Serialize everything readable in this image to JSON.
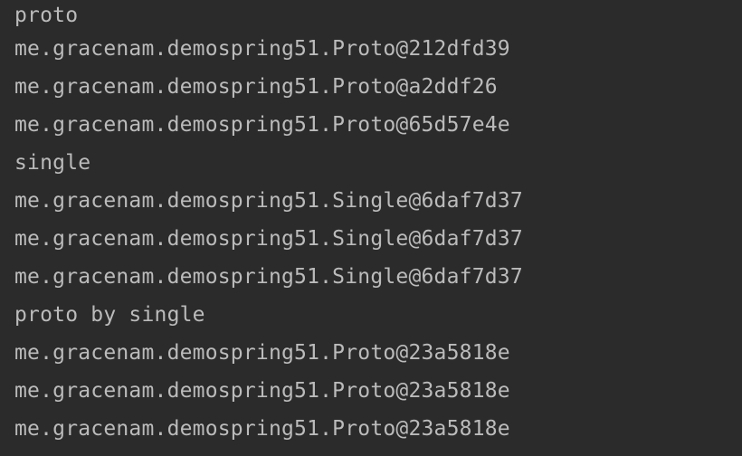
{
  "console": {
    "lines": [
      "proto",
      "me.gracenam.demospring51.Proto@212dfd39",
      "me.gracenam.demospring51.Proto@a2ddf26",
      "me.gracenam.demospring51.Proto@65d57e4e",
      "single",
      "me.gracenam.demospring51.Single@6daf7d37",
      "me.gracenam.demospring51.Single@6daf7d37",
      "me.gracenam.demospring51.Single@6daf7d37",
      "proto by single",
      "me.gracenam.demospring51.Proto@23a5818e",
      "me.gracenam.demospring51.Proto@23a5818e",
      "me.gracenam.demospring51.Proto@23a5818e"
    ]
  },
  "colors": {
    "background": "#2b2b2b",
    "text": "#bbbbbb"
  }
}
